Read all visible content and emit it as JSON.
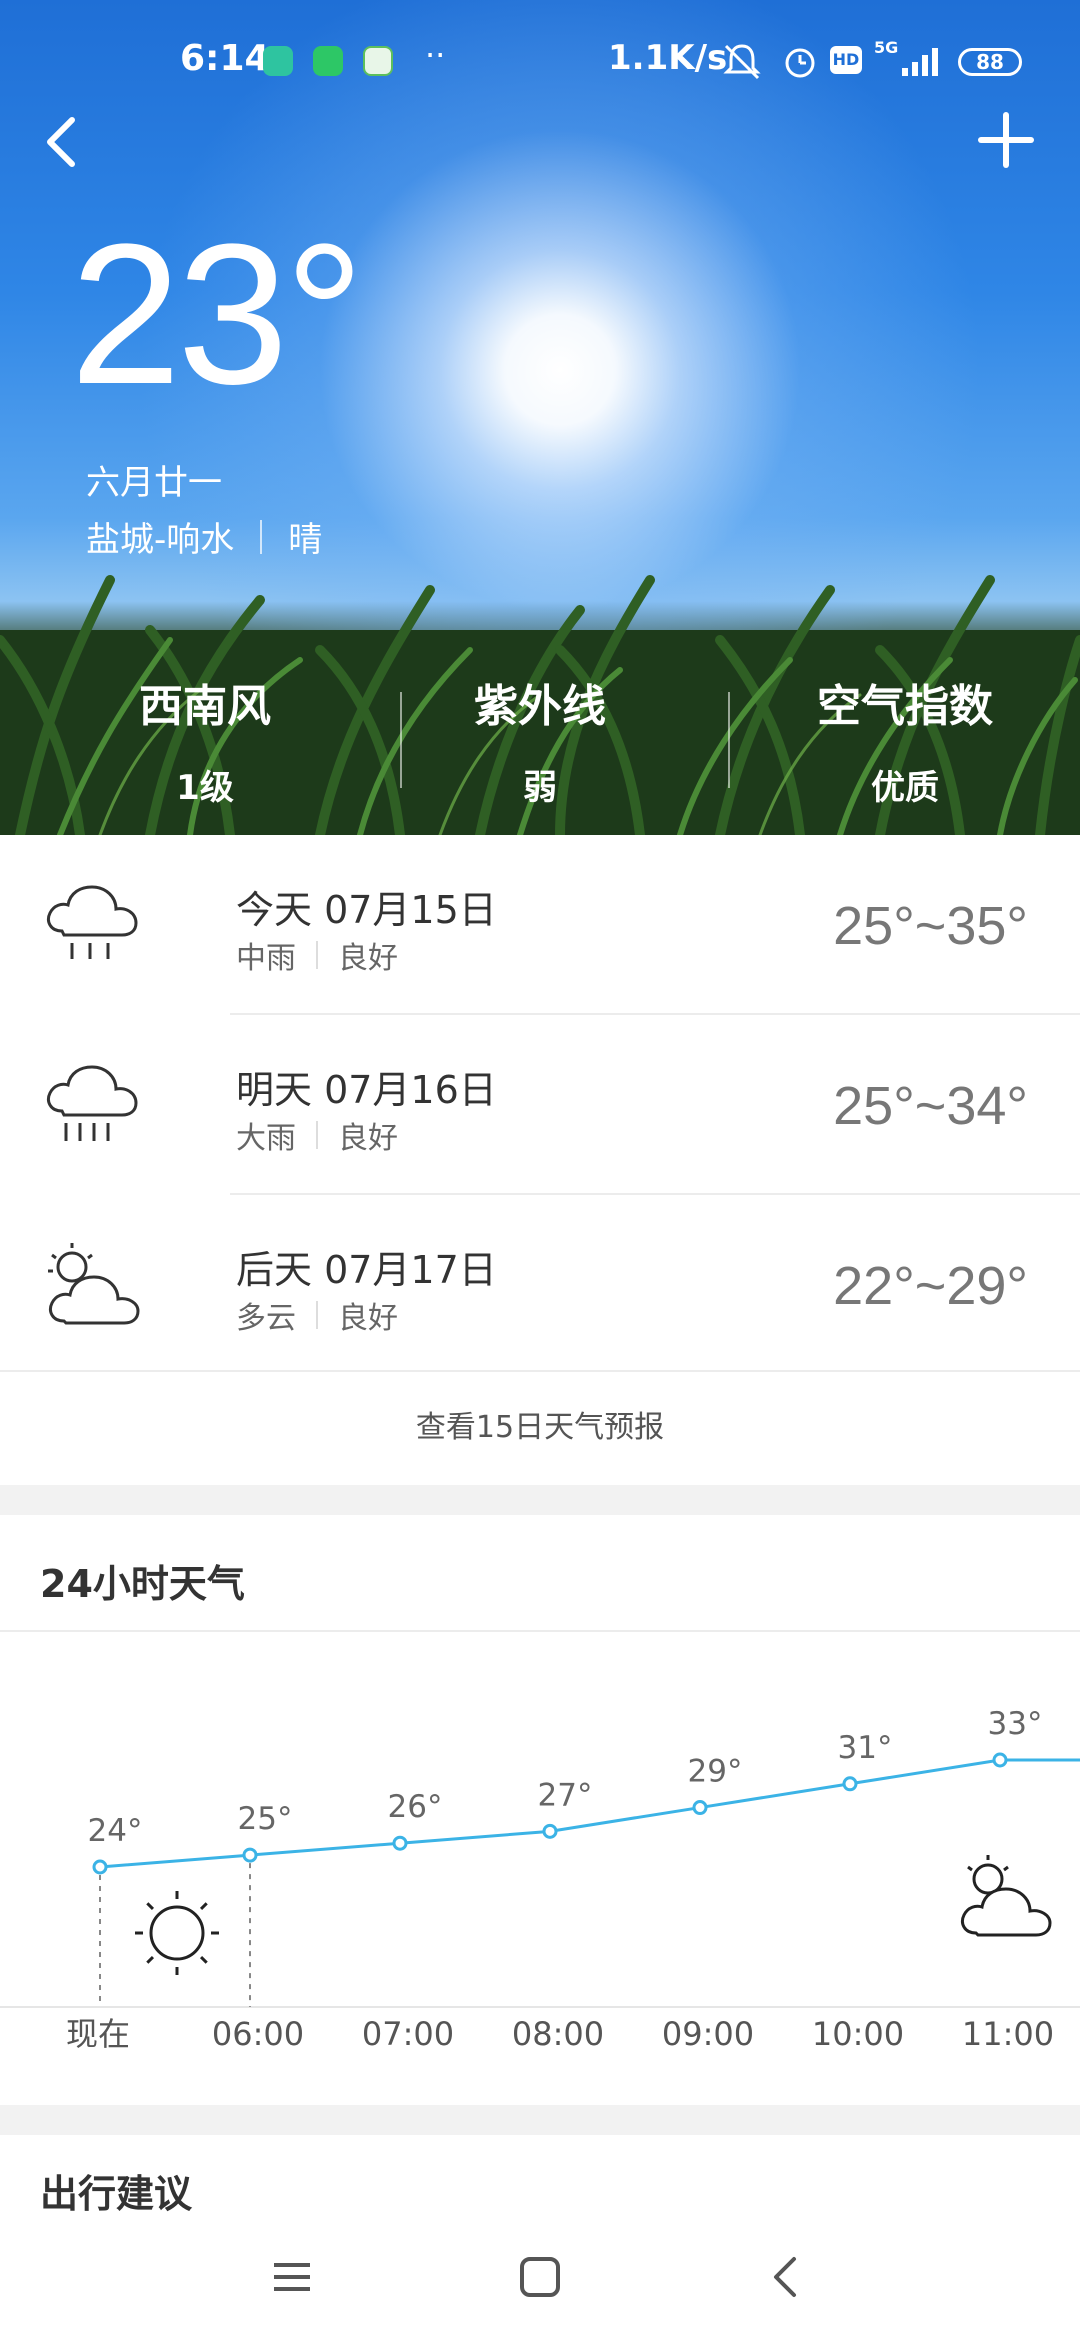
{
  "status_bar": {
    "time": "6:14",
    "net_speed": "1.1K/s",
    "network": "5G",
    "battery": "88",
    "hd_badge": "HD",
    "app_icons": [
      "app-icon-1",
      "wechat-icon",
      "wifi-app-icon"
    ],
    "more": "··"
  },
  "hero": {
    "temperature": "23°",
    "lunar_date": "六月廿一",
    "location": "盐城-响水",
    "condition": "晴",
    "metrics": [
      {
        "label": "西南风",
        "value": "1级"
      },
      {
        "label": "紫外线",
        "value": "弱"
      },
      {
        "label": "空气指数",
        "value": "优质"
      }
    ]
  },
  "forecast": {
    "days": [
      {
        "day": "今天 07月15日",
        "condition": "中雨",
        "air": "良好",
        "range": "25°~35°",
        "icon": "rain-cloud-icon"
      },
      {
        "day": "明天 07月16日",
        "condition": "大雨",
        "air": "良好",
        "range": "25°~34°",
        "icon": "heavy-rain-cloud-icon"
      },
      {
        "day": "后天 07月17日",
        "condition": "多云",
        "air": "良好",
        "range": "22°~29°",
        "icon": "partly-cloudy-icon"
      }
    ],
    "more_label": "查看15日天气预报"
  },
  "hourly": {
    "title": "24小时天气",
    "chart_data": {
      "type": "line",
      "categories": [
        "现在",
        "06:00",
        "07:00",
        "08:00",
        "09:00",
        "10:00",
        "11:00"
      ],
      "series": [
        {
          "values": [
            24,
            25,
            26,
            27,
            29,
            31,
            33
          ]
        }
      ],
      "value_labels": [
        "24°",
        "25°",
        "26°",
        "27°",
        "29°",
        "31°",
        "33°"
      ],
      "line_color": "#3bb3e6",
      "icons": [
        {
          "at": "现在",
          "icon": "sun-icon"
        },
        {
          "at": "11:00",
          "icon": "partly-cloudy-icon"
        }
      ]
    }
  },
  "travel": {
    "title": "出行建议"
  },
  "colors": {
    "accent_line": "#3bb3e6",
    "card_bg": "#ffffff",
    "page_bg": "#f2f2f2"
  }
}
